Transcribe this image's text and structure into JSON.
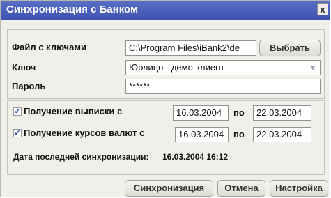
{
  "window": {
    "title": "Синхронизация с Банком",
    "close_label": "x"
  },
  "keys": {
    "file_label": "Файл с ключами",
    "file_value": "C:\\Program Files\\iBank2\\de",
    "choose_button": "Выбрать",
    "key_label": "Ключ",
    "key_value": "Юрлицо - демо-клиент",
    "password_label": "Пароль",
    "password_value": "******"
  },
  "sync": {
    "statement_label": "Получение выписки с",
    "statement_from": "16.03.2004",
    "statement_to_label": "по",
    "statement_to": "22.03.2004",
    "rates_label": "Получение курсов валют с",
    "rates_from": "16.03.2004",
    "rates_to_label": "по",
    "rates_to": "22.03.2004",
    "last_sync_label": "Дата последней синхронизации:",
    "last_sync_value": "16.03.2004 16:12",
    "statement_checked": true,
    "rates_checked": true
  },
  "footer": {
    "sync_button": "Синхронизация",
    "cancel_button": "Отмена",
    "settings_button": "Настройка"
  },
  "icons": {
    "check": "check-icon",
    "dropdown": "chevron-down-icon"
  }
}
